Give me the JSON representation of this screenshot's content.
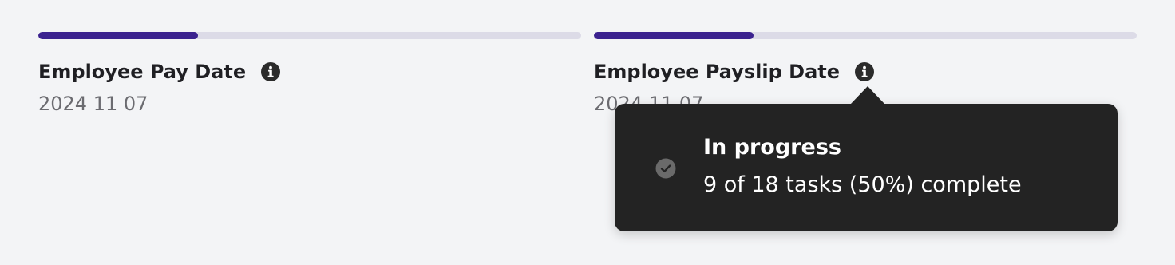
{
  "colors": {
    "background": "#f3f4f6",
    "progress_fill": "#3b228f",
    "progress_track": "#dcdbe7",
    "info_icon": "#2b2b2b",
    "tooltip_background": "#232323",
    "status_icon": "#6a6a6a"
  },
  "milestones": [
    {
      "title": "Employee Pay Date",
      "date": "2024 11 07",
      "progress": 0.294,
      "icon": "info-icon"
    },
    {
      "title": "Employee Payslip Date",
      "date": "2024 11 07",
      "progress": 0.294,
      "icon": "info-icon"
    }
  ],
  "tooltip": {
    "status_icon": "check-circle-icon",
    "title": "In progress",
    "detail": "9 of 18 tasks (50%) complete"
  }
}
